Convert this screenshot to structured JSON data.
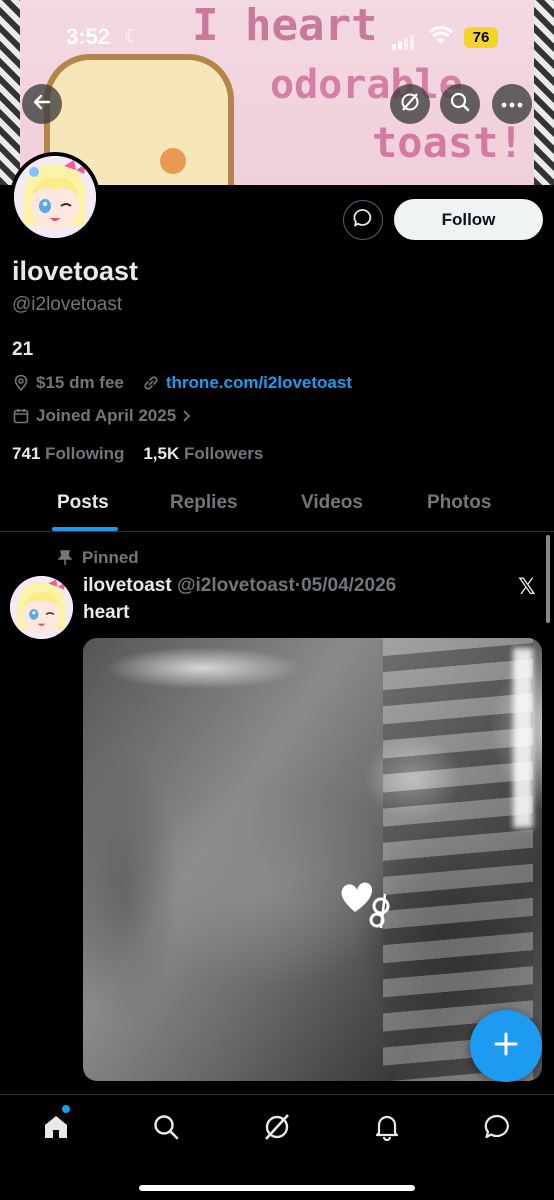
{
  "status_bar": {
    "time": "3:52",
    "battery": "76"
  },
  "banner": {
    "text_line1": "I heart",
    "text_line2": "odorable",
    "text_line3": "toast!"
  },
  "profile": {
    "name": "ilovetoast",
    "handle": "@i2lovetoast",
    "bio": "21",
    "location": "$15 dm fee",
    "website": "throne.com/i2lovetoast",
    "joined": "Joined April 2025",
    "following_count": "741",
    "following_label": "Following",
    "followers_count": "1,5K",
    "followers_label": "Followers",
    "follow_button": "Follow"
  },
  "tabs": [
    {
      "label": "Posts",
      "active": true
    },
    {
      "label": "Replies",
      "active": false
    },
    {
      "label": "Videos",
      "active": false
    },
    {
      "label": "Photos",
      "active": false
    }
  ],
  "pinned_post": {
    "pinned_label": "Pinned",
    "author_name": "ilovetoast",
    "author_handle": "@i2lovetoast",
    "separator": "·",
    "date": "05/04/2026",
    "text": "heart",
    "x_logo": "𝕏"
  },
  "icons": {
    "back": "back-arrow-icon",
    "grok": "grok-icon",
    "search": "search-icon",
    "more": "more-icon",
    "message": "message-icon",
    "location": "location-pin-icon",
    "link": "link-icon",
    "calendar": "calendar-icon",
    "pin": "pin-icon",
    "compose": "plus-icon"
  },
  "colors": {
    "accent": "#1d9bf0",
    "background": "#000000",
    "secondary_text": "#71767b",
    "battery": "#f5d42a"
  }
}
